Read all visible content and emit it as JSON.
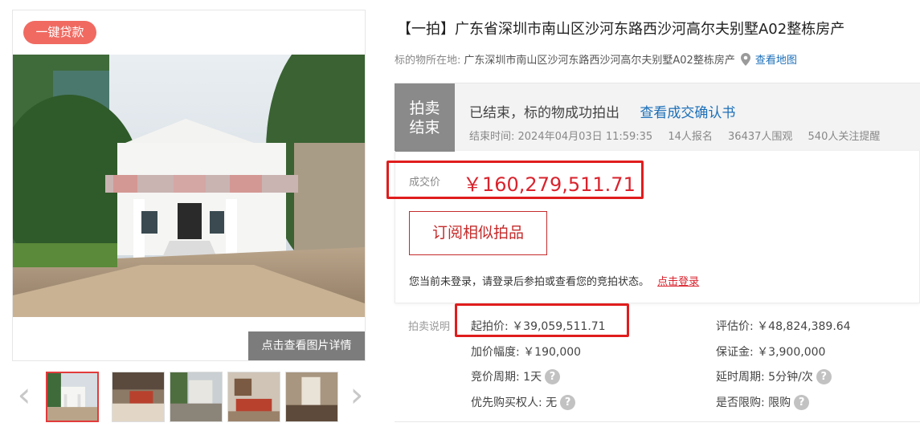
{
  "gallery": {
    "loan_badge": "一键贷款",
    "photo_detail_button": "点击查看图片详情",
    "prev_arrow": "‹",
    "next_arrow": "›"
  },
  "title": "【一拍】广东省深圳市南山区沙河东路西沙河高尔夫别墅A02整栋房产",
  "location": {
    "label": "标的物所在地:",
    "address": "广东深圳市南山区沙河东路西沙河高尔夫别墅A02整栋房产",
    "map_link": "查看地图"
  },
  "status": {
    "tag_line1": "拍卖",
    "tag_line2": "结束",
    "message": "已结束，标的物成功拍出",
    "confirm_link": "查看成交确认书",
    "end_time": "结束时间:  2024年04月03日 11:59:35",
    "signups": "14人报名",
    "views": "36437人围观",
    "followers": "540人关注提醒"
  },
  "deal": {
    "label": "成交价",
    "price": "￥160,279,511.71"
  },
  "subscribe_button": "订阅相似拍品",
  "login": {
    "tip": "您当前未登录，请登录后参拍或查看您的竞拍状态。",
    "link": "点击登录"
  },
  "auction_info": {
    "label": "拍卖说明",
    "start_price": "起拍价:  ￥39,059,511.71",
    "appraisal": "评估价:  ￥48,824,389.64",
    "increment": "加价幅度:  ￥190,000",
    "deposit": "保证金:  ￥3,900,000",
    "cycle": "竞价周期:  1天",
    "delay": "延时周期:  5分钟/次",
    "priority": "优先购买权人:  无",
    "purchase_limit": "是否限购:  限购",
    "help_glyph": "?"
  },
  "colors": {
    "accent_red": "#d9232d",
    "badge_red": "#f06a61",
    "link_blue": "#1b6fb8",
    "status_gray": "#8a8a8a"
  }
}
